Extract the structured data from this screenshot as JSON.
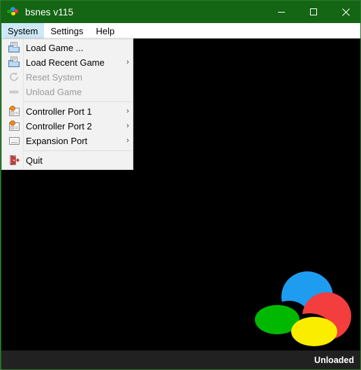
{
  "window": {
    "title": "bsnes v115",
    "icon": "bsnes-logo-icon",
    "accent_color": "#146614",
    "controls": [
      {
        "name": "minimize",
        "glyph": "minimize-icon"
      },
      {
        "name": "maximize",
        "glyph": "maximize-icon"
      },
      {
        "name": "close",
        "glyph": "close-icon"
      }
    ]
  },
  "menubar": {
    "items": [
      {
        "label": "System",
        "active": true
      },
      {
        "label": "Settings",
        "active": false
      },
      {
        "label": "Help",
        "active": false
      }
    ]
  },
  "system_menu": {
    "open": true,
    "items": [
      {
        "label": "Load Game ...",
        "icon": "open-folder-icon",
        "disabled": false,
        "submenu": false
      },
      {
        "label": "Load Recent Game",
        "icon": "open-folder-icon",
        "disabled": false,
        "submenu": true
      },
      {
        "label": "Reset System",
        "icon": "reset-icon",
        "disabled": true,
        "submenu": false
      },
      {
        "label": "Unload Game",
        "icon": "eject-icon",
        "disabled": true,
        "submenu": false
      },
      {
        "separator": true
      },
      {
        "label": "Controller Port 1",
        "icon": "controller-port-icon",
        "disabled": false,
        "submenu": true
      },
      {
        "label": "Controller Port 2",
        "icon": "controller-port-icon",
        "disabled": false,
        "submenu": true
      },
      {
        "label": "Expansion Port",
        "icon": "expansion-port-icon",
        "disabled": false,
        "submenu": true
      },
      {
        "separator": true
      },
      {
        "label": "Quit",
        "icon": "quit-icon",
        "disabled": false,
        "submenu": false
      }
    ],
    "submenu_arrow": "›"
  },
  "viewport": {
    "background_color": "#000000",
    "logo": {
      "name": "bsnes-logo",
      "colors": {
        "blue": "#1e9cf0",
        "red": "#f43d3d",
        "green": "#00b800",
        "yellow": "#fbed00"
      }
    }
  },
  "statusbar": {
    "text": "Unloaded",
    "background_color": "#212121"
  }
}
